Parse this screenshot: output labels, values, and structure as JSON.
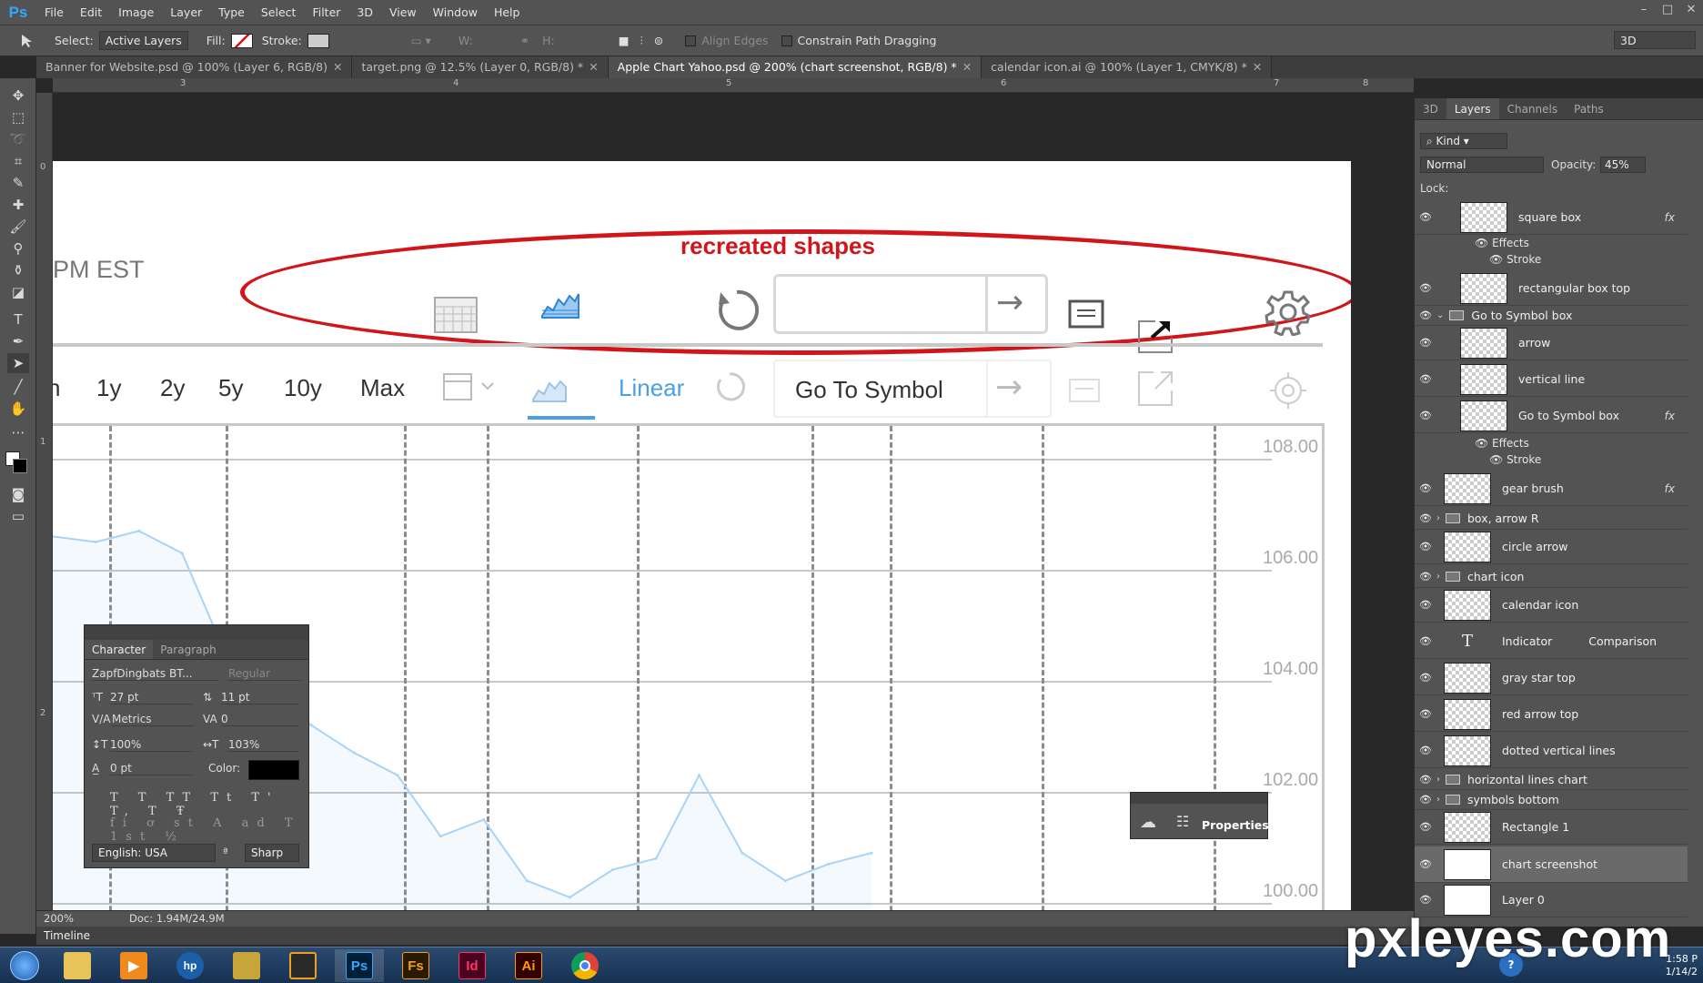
{
  "app": {
    "logo": "Ps"
  },
  "menu": [
    "File",
    "Edit",
    "Image",
    "Layer",
    "Type",
    "Select",
    "Filter",
    "3D",
    "View",
    "Window",
    "Help"
  ],
  "window_controls": [
    "–",
    "□",
    "✕"
  ],
  "options": {
    "select_label": "Select:",
    "select_value": "Active Layers",
    "fill_label": "Fill:",
    "stroke_label": "Stroke:",
    "w_label": "W:",
    "h_label": "H:",
    "align_edges": "Align Edges",
    "constrain": "Constrain Path Dragging",
    "workspace": "3D"
  },
  "tabs": [
    {
      "label": "Banner for Website.psd @ 100% (Layer 6, RGB/8)"
    },
    {
      "label": "target.png @ 12.5% (Layer 0, RGB/8) *"
    },
    {
      "label": "Apple Chart Yahoo.psd @ 200% (chart screenshot, RGB/8) *"
    },
    {
      "label": "calendar icon.ai @ 100% (Layer 1, CMYK/8) *"
    }
  ],
  "ruler": {
    "h": [
      "3",
      "4",
      "5",
      "6",
      "7",
      "8"
    ],
    "v": [
      "0",
      "1",
      "2"
    ]
  },
  "canvas": {
    "time_label": "PM EST",
    "annotation": "recreated shapes",
    "ranges": [
      "1y",
      "2y",
      "5y",
      "10y",
      "Max"
    ],
    "partial_range": "n",
    "scale_label": "Linear",
    "goto_label": "Go To Symbol",
    "yticks": [
      "108.00",
      "106.00",
      "104.00",
      "102.00",
      "100.00"
    ]
  },
  "chart_data": {
    "type": "line",
    "series": [
      {
        "values": [
          106.6,
          106.5,
          106.7,
          106.3,
          104.5,
          103.8,
          103.2,
          102.7,
          102.3,
          101.2,
          101.5,
          100.4,
          100.1,
          100.6,
          100.8,
          102.3,
          100.9,
          100.4,
          100.7,
          100.9
        ]
      }
    ],
    "ylim": [
      100,
      108
    ],
    "yticks": [
      "108.00",
      "106.00",
      "104.00",
      "102.00",
      "100.00"
    ],
    "grid": true
  },
  "character_panel": {
    "tabs": [
      "Character",
      "Paragraph"
    ],
    "font_family": "ZapfDingbats BT...",
    "font_style": "Regular",
    "size": "27 pt",
    "leading": "11 pt",
    "kerning": "Metrics",
    "tracking": "0",
    "vscale": "100%",
    "hscale": "103%",
    "baseline": "0 pt",
    "color_label": "Color:",
    "language": "English: USA",
    "aa_label": "ª",
    "aa": "Sharp"
  },
  "properties_label": "Properties",
  "layers_panel": {
    "tabs": [
      "3D",
      "Layers",
      "Channels",
      "Paths"
    ],
    "filter": "Kind",
    "blend": "Normal",
    "opacity_label": "Opacity:",
    "opacity": "45%",
    "lock_label": "Lock:",
    "layers": [
      {
        "name": "square box",
        "fx": "fx"
      },
      {
        "name": "Effects"
      },
      {
        "name": "Stroke"
      },
      {
        "name": "rectangular box top"
      },
      {
        "name": "Go to Symbol box"
      },
      {
        "name": "arrow"
      },
      {
        "name": "vertical line"
      },
      {
        "name": "Go to Symbol box",
        "fx": "fx"
      },
      {
        "name": "Effects"
      },
      {
        "name": "Stroke"
      },
      {
        "name": "gear brush",
        "fx": "fx"
      },
      {
        "name": "box, arrow R"
      },
      {
        "name": "circle arrow"
      },
      {
        "name": "chart icon"
      },
      {
        "name": "calendar icon"
      },
      {
        "name": "Indicator",
        "extra": "Comparison"
      },
      {
        "name": "gray star top"
      },
      {
        "name": "red arrow top"
      },
      {
        "name": "dotted vertical lines"
      },
      {
        "name": "horizontal lines chart"
      },
      {
        "name": "symbols bottom"
      },
      {
        "name": "Rectangle 1"
      },
      {
        "name": "chart screenshot"
      },
      {
        "name": "Layer 0"
      }
    ]
  },
  "status": {
    "zoom": "200%",
    "doc": "Doc: 1.94M/24.9M"
  },
  "timeline_label": "Timeline",
  "taskbar": {
    "apps": [
      "Fs",
      "Id",
      "Ai",
      "Ps"
    ],
    "watermark": "pxleyes.com",
    "time": "1:58 P",
    "date": "1/14/2"
  },
  "colors": {
    "accent": "#31a8ff",
    "annotation_red": "#d0161b",
    "chart_blue": "#4aa0e6"
  }
}
